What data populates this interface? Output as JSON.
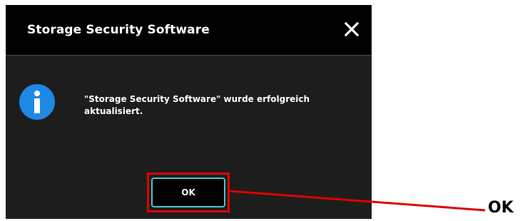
{
  "dialog": {
    "title": "Storage Security Software",
    "close_icon": "close-icon",
    "info_icon": "info-icon",
    "message_line1": "\"Storage Security Software\" wurde erfolgreich",
    "message_line2": "aktualisiert.",
    "ok_label": "OK"
  },
  "annotation": {
    "label": "OK",
    "highlight_color": "#e00000"
  },
  "colors": {
    "dialog_background": "#1d1d1d",
    "titlebar_background": "#000000",
    "info_icon_color": "#1e88e5",
    "button_border": "#3ec9d6"
  }
}
